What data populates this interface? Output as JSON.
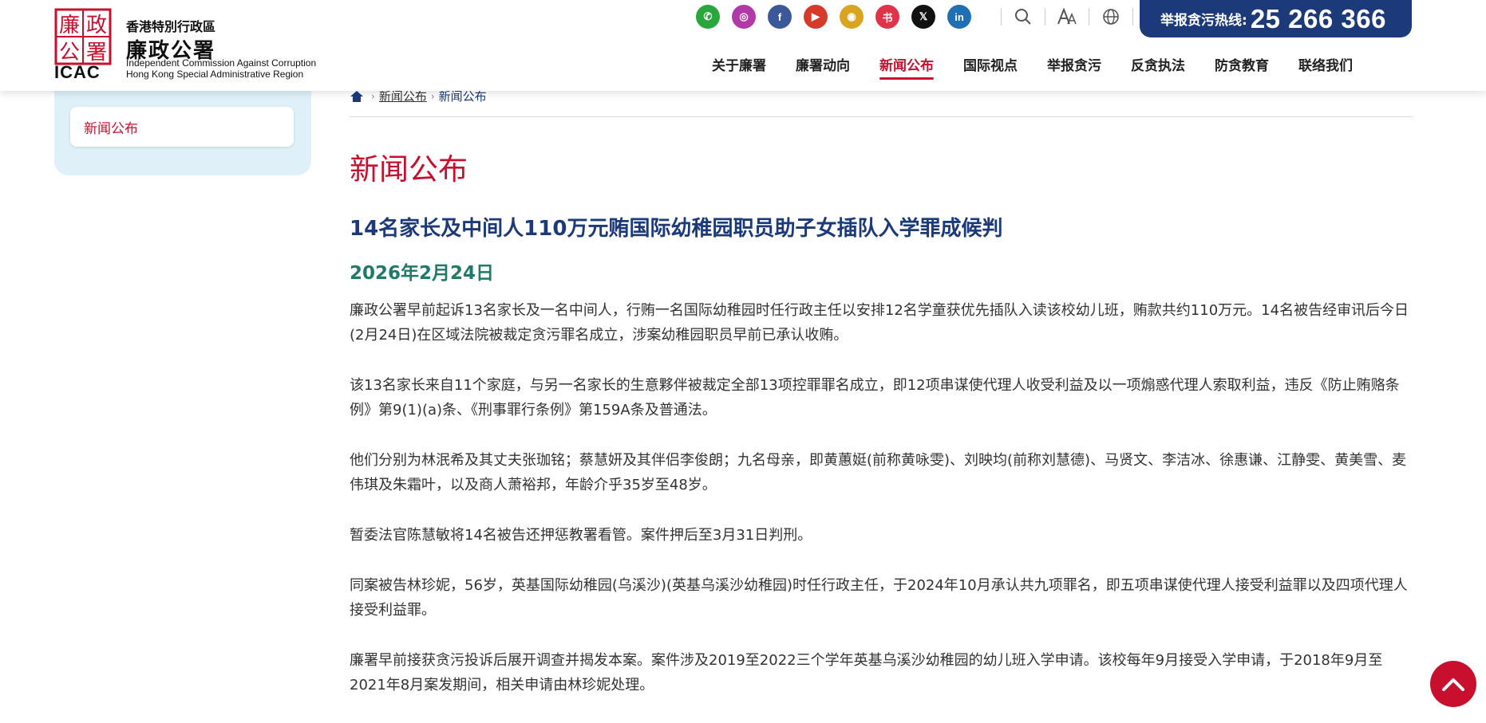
{
  "header": {
    "logo": {
      "seal_chars": [
        "廉",
        "政",
        "公",
        "署"
      ],
      "acronym": "ICAC",
      "zh_small": "香港特別行政區",
      "zh_big": "廉政公署",
      "en_line1": "Independent Commission Against Corruption",
      "en_line2": "Hong Kong Special Administrative Region"
    },
    "social": [
      {
        "name": "wechat-icon",
        "color": "#2aa63d",
        "glyph": "✆"
      },
      {
        "name": "instagram-icon",
        "color": "#b23aa8",
        "glyph": "◎"
      },
      {
        "name": "facebook-icon",
        "color": "#3b5998",
        "glyph": "f"
      },
      {
        "name": "youtube-icon",
        "color": "#d63a2a",
        "glyph": "▶"
      },
      {
        "name": "weibo-icon",
        "color": "#d9a420",
        "glyph": "◉"
      },
      {
        "name": "xiaohongshu-icon",
        "color": "#e0334a",
        "glyph": "书"
      },
      {
        "name": "x-icon",
        "color": "#111111",
        "glyph": "𝕏"
      },
      {
        "name": "linkedin-icon",
        "color": "#1f6fb2",
        "glyph": "in"
      }
    ],
    "hotline": {
      "label": "举报贪污热线:",
      "number": "25 266 366"
    },
    "nav": [
      "关于廉署",
      "廉署动向",
      "新闻公布",
      "国际视点",
      "举报贪污",
      "反贪执法",
      "防贪教育",
      "联络我们"
    ],
    "nav_active": 2
  },
  "sidebar": {
    "items": [
      {
        "label": "新闻公布"
      }
    ]
  },
  "breadcrumb": {
    "items": [
      "新闻公布",
      "新闻公布"
    ]
  },
  "page": {
    "title": "新闻公布",
    "article_title": "14名家长及中间人110万元贿国际幼稚园职员助子女插队入学罪成候判",
    "date": "2026年2月24日",
    "paragraphs": [
      "廉政公署早前起诉13名家长及一名中间人，行贿一名国际幼稚园时任行政主任以安排12名学童获优先插队入读该校幼儿班，贿款共约110万元。14名被告经审讯后今日(2月24日)在区域法院被裁定贪污罪名成立，涉案幼稚园职员早前已承认收贿。",
      "该13名家长来自11个家庭，与另一名家长的生意夥伴被裁定全部13项控罪罪名成立，即12项串谋使代理人收受利益及以一项煽惑代理人索取利益，违反《防止贿赂条例》第9(1)(a)条、《刑事罪行条例》第159A条及普通法。",
      "他们分别为林泯希及其丈夫张珈铭；蔡慧妍及其伴侣李俊朗；九名母亲，即黄蕙娗(前称黄咏雯)、刘映均(前称刘慧德)、马贤文、李洁冰、徐惠谦、江静雯、黄美雪、麦伟琪及朱霜叶，以及商人萧裕邦，年龄介乎35岁至48岁。",
      "暂委法官陈慧敏将14名被告还押惩教署看管。案件押后至3月31日判刑。",
      "同案被告林珍妮，56岁，英基国际幼稚园(乌溪沙)(英基乌溪沙幼稚园)时任行政主任，于2024年10月承认共九项罪名，即五项串谋使代理人接受利益罪以及四项代理人接受利益罪。",
      "廉署早前接获贪污投诉后展开调查并揭发本案。案件涉及2019至2022三个学年英基乌溪沙幼稚园的幼儿班入学申请。该校每年9月接受入学申请，于2018年9月至2021年8月案发期间，相关申请由林珍妮处理。"
    ]
  },
  "colors": {
    "brand_red": "#c8102e",
    "navy": "#1c3a7a",
    "date_green": "#1f7a6a",
    "sidebar_bg": "#dff0f8"
  }
}
